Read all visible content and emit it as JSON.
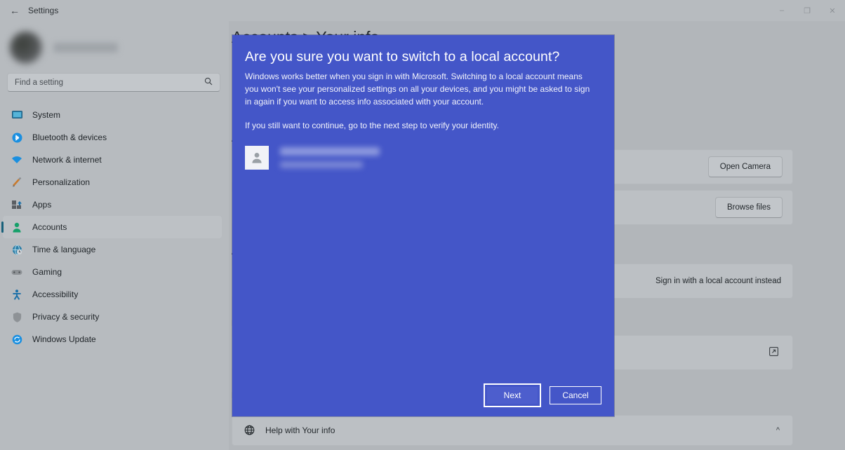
{
  "titlebar": {
    "back_icon": "back-arrow-icon",
    "title": "Settings",
    "minimize": "–",
    "maximize": "❐",
    "close": "✕"
  },
  "sidebar": {
    "profile": {
      "redacted": true
    },
    "search": {
      "placeholder": "Find a setting",
      "value": "",
      "icon": "search-icon"
    },
    "items": [
      {
        "label": "System",
        "icon": "monitor-icon",
        "selected": false
      },
      {
        "label": "Bluetooth & devices",
        "icon": "bluetooth-icon",
        "selected": false
      },
      {
        "label": "Network & internet",
        "icon": "wifi-icon",
        "selected": false
      },
      {
        "label": "Personalization",
        "icon": "paintbrush-icon",
        "selected": false
      },
      {
        "label": "Apps",
        "icon": "apps-icon",
        "selected": false
      },
      {
        "label": "Accounts",
        "icon": "person-icon",
        "selected": true
      },
      {
        "label": "Time & language",
        "icon": "globe-clock-icon",
        "selected": false
      },
      {
        "label": "Gaming",
        "icon": "gamepad-icon",
        "selected": false
      },
      {
        "label": "Accessibility",
        "icon": "accessibility-icon",
        "selected": false
      },
      {
        "label": "Privacy & security",
        "icon": "shield-icon",
        "selected": false
      },
      {
        "label": "Windows Update",
        "icon": "update-icon",
        "selected": false
      }
    ]
  },
  "main": {
    "page_title": "Accounts  >  Your info",
    "sections": [
      {
        "label": "A"
      },
      {
        "label": "A"
      },
      {
        "label": "R"
      },
      {
        "label": "R"
      }
    ],
    "rows": {
      "open_camera": "Open Camera",
      "browse_files": "Browse files",
      "local_account": "Sign in with a local account instead",
      "external_link_icon": "external-link-icon"
    },
    "help": {
      "icon": "help-globe-icon",
      "label": "Help with Your info",
      "collapse_icon": "chevron-up-icon"
    }
  },
  "dialog": {
    "title": "Are you sure you want to switch to a local account?",
    "paragraph1": "Windows works better when you sign in with Microsoft. Switching to a local account means you won't see your personalized settings on all your devices, and you might be asked to sign in again if you want to access info associated with your account.",
    "paragraph2": "If you still want to continue, go to the next step to verify your identity.",
    "account": {
      "avatar_icon": "person-avatar-icon",
      "redacted": true
    },
    "next_label": "Next",
    "cancel_label": "Cancel",
    "accent_color": "#4456c8"
  }
}
